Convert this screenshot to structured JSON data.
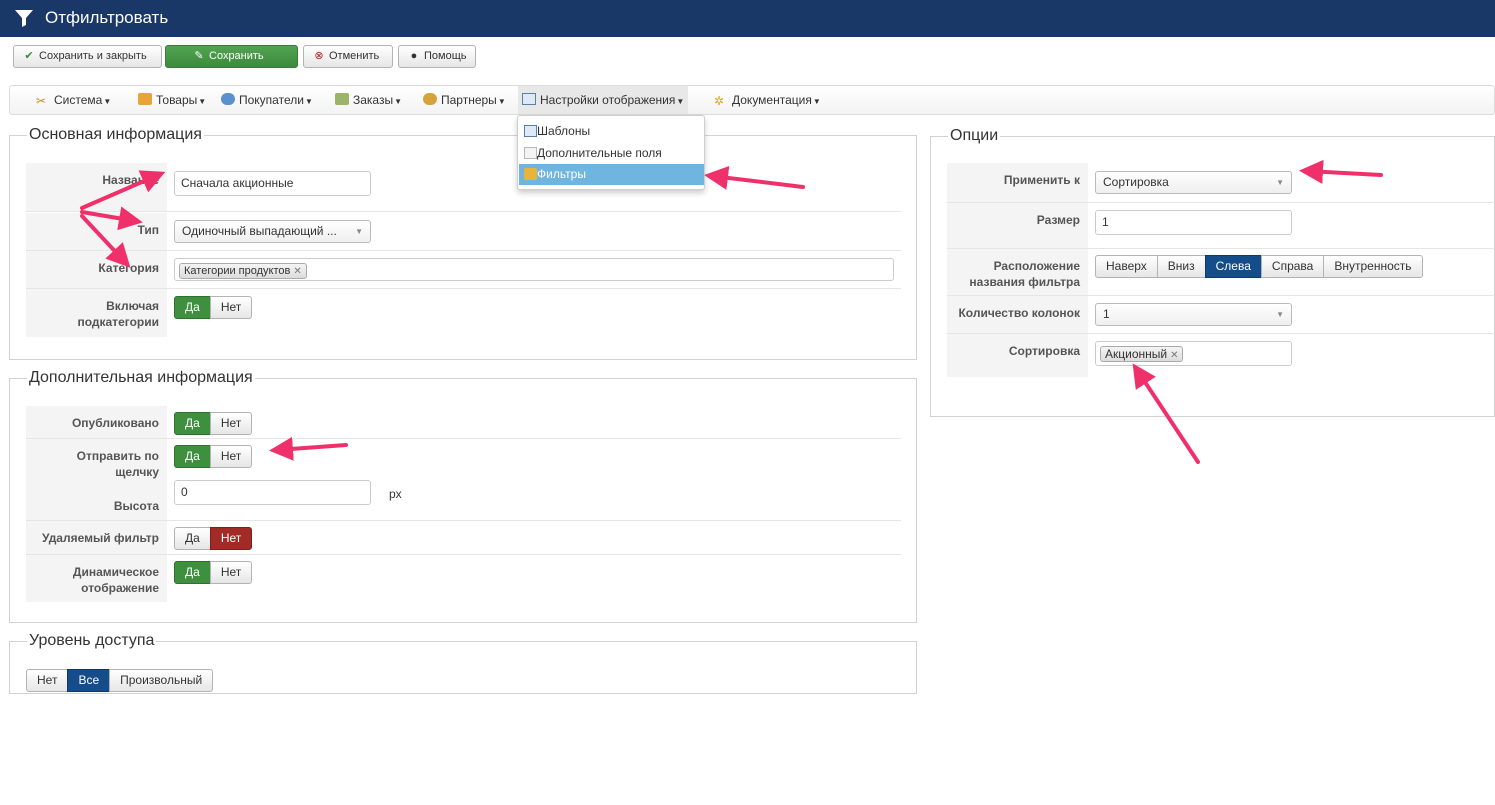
{
  "header": {
    "title": "Отфильтровать",
    "icon": "funnel-icon"
  },
  "toolbar": {
    "save_close": "Сохранить и закрыть",
    "save": "Сохранить",
    "cancel": "Отменить",
    "help": "Помощь"
  },
  "menu": {
    "items": [
      "Система",
      "Товары",
      "Покупатели",
      "Заказы",
      "Партнеры",
      "Настройки отображения",
      "Документация"
    ],
    "dropdown": [
      "Шаблоны",
      "Дополнительные поля",
      "Фильтры"
    ],
    "dropdown_selected": "Фильтры"
  },
  "basic": {
    "legend": "Основная информация",
    "name_label": "Название",
    "name_value": "Сначала акционные",
    "type_label": "Тип",
    "type_value": "Одиночный выпадающий ...",
    "category_label": "Категория",
    "category_chip": "Категории продуктов",
    "subcat_label": "Включая подкатегории",
    "yes": "Да",
    "no": "Нет"
  },
  "extra": {
    "legend": "Дополнительная информация",
    "published_label": "Опубликовано",
    "submit_click_label": "Отправить по щелчку",
    "height_label": "Высота",
    "height_value": "0",
    "height_unit": "px",
    "removable_label": "Удаляемый фильтр",
    "dynamic_label": "Динамическое отображение",
    "yes": "Да",
    "no": "Нет"
  },
  "access": {
    "legend": "Уровень доступа",
    "options": [
      "Нет",
      "Все",
      "Произвольный"
    ],
    "selected": "Все"
  },
  "options": {
    "legend": "Опции",
    "apply_label": "Применить к",
    "apply_value": "Сортировка",
    "size_label": "Размер",
    "size_value": "1",
    "position_label": "Расположение названия фильтра",
    "positions": [
      "Наверх",
      "Вниз",
      "Слева",
      "Справа",
      "Внутренность"
    ],
    "position_selected": "Слева",
    "columns_label": "Количество колонок",
    "columns_value": "1",
    "sort_label": "Сортировка",
    "sort_chip": "Акционный"
  },
  "colors": {
    "header_bg": "#1a3867",
    "toggle_green": "#3e8f3e",
    "toggle_red": "#a12b26",
    "toggle_blue": "#154d8a",
    "annotation_arrow": "#f0306a"
  }
}
